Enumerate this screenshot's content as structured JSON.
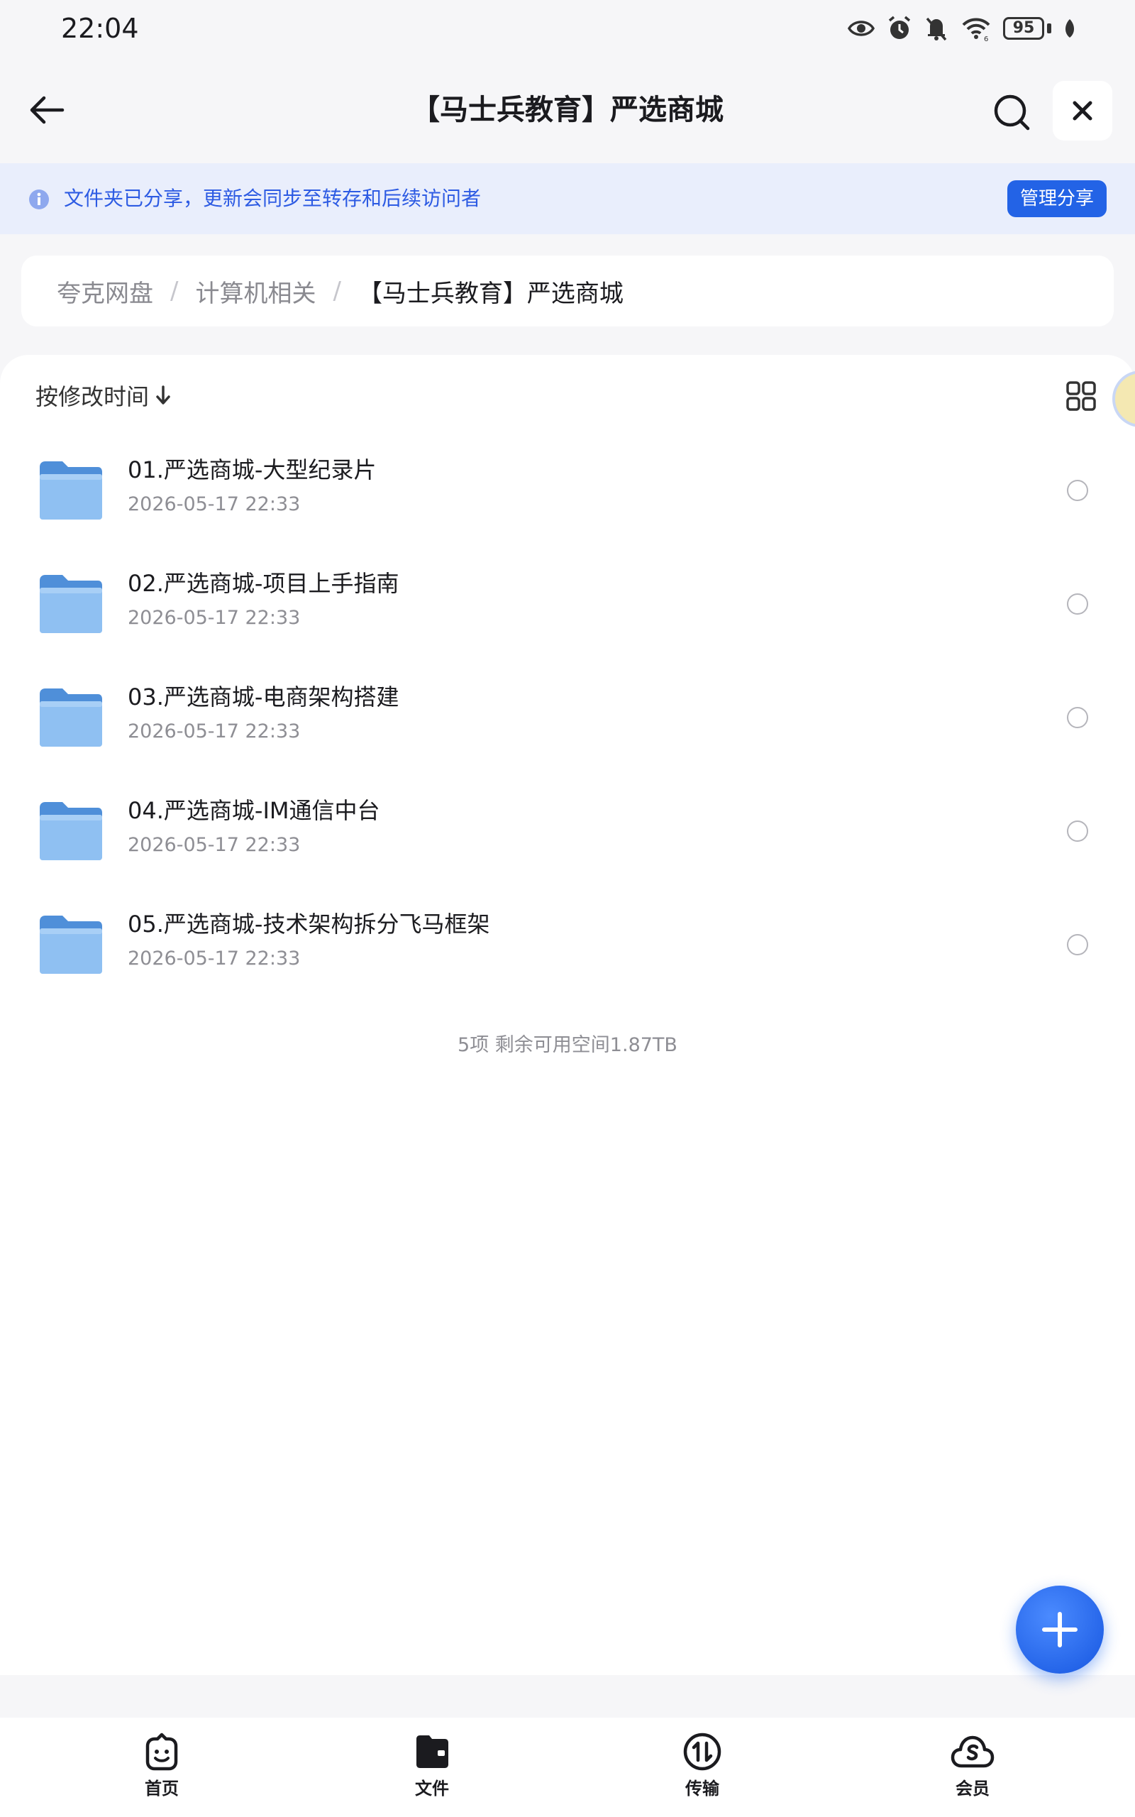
{
  "status_bar": {
    "time": "22:04",
    "battery": "95",
    "icons": [
      "eye-icon",
      "alarm-icon",
      "mute-icon",
      "wifi-icon",
      "battery-icon",
      "leaf-icon"
    ]
  },
  "header": {
    "title": "【马士兵教育】严选商城",
    "back_icon": "arrow-left-icon",
    "search_icon": "search-icon",
    "close_icon": "close-icon"
  },
  "share_banner": {
    "text": "文件夹已分享，更新会同步至转存和后续访问者",
    "button_label": "管理分享",
    "accent": "#2363e6"
  },
  "breadcrumb": {
    "items": [
      "夸克网盘",
      "计算机相关",
      "【马士兵教育】严选商城"
    ],
    "separator": "/"
  },
  "list": {
    "sort_label": "按修改时间",
    "files": [
      {
        "name": "01.严选商城-大型纪录片",
        "date": "2026-05-17 22:33"
      },
      {
        "name": "02.严选商城-项目上手指南",
        "date": "2026-05-17 22:33"
      },
      {
        "name": "03.严选商城-电商架构搭建",
        "date": "2026-05-17 22:33"
      },
      {
        "name": "04.严选商城-IM通信中台",
        "date": "2026-05-17 22:33"
      },
      {
        "name": "05.严选商城-技术架构拆分飞马框架",
        "date": "2026-05-17 22:33"
      }
    ],
    "summary": "5项 剩余可用空间1.87TB"
  },
  "bottom_nav": {
    "items": [
      {
        "label": "首页",
        "icon": "home-face-icon"
      },
      {
        "label": "文件",
        "icon": "folder-icon"
      },
      {
        "label": "传输",
        "icon": "transfer-icon"
      },
      {
        "label": "会员",
        "icon": "member-cloud-icon"
      }
    ]
  }
}
